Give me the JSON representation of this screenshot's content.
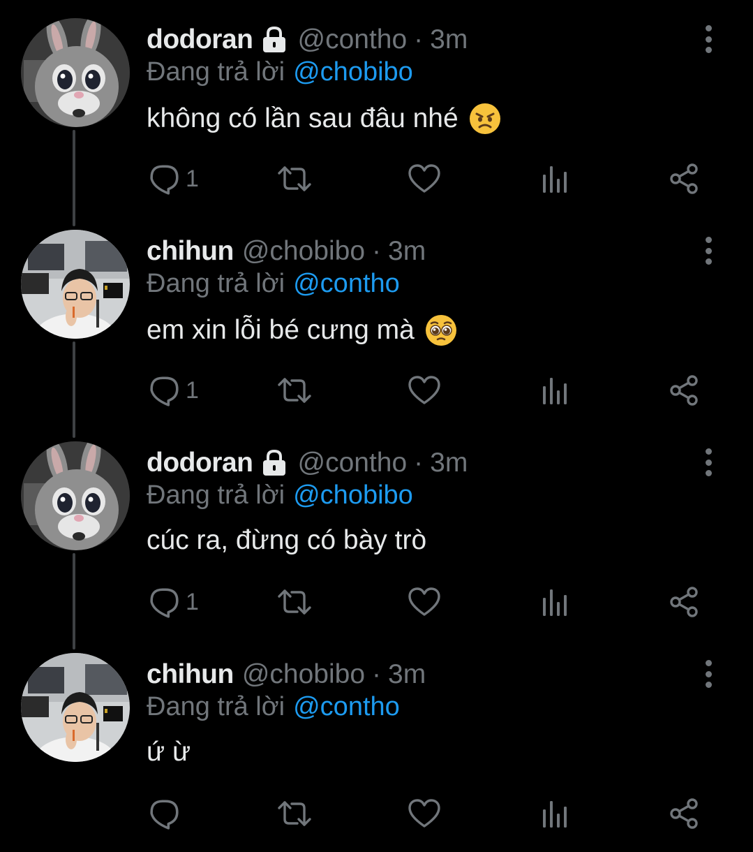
{
  "colors": {
    "background": "#000000",
    "primary_text": "#e7e9ea",
    "secondary_text": "#71767b",
    "link": "#1d9bf0",
    "thread_line": "#3e4144"
  },
  "tweets": [
    {
      "display_name": "dodoran",
      "protected": true,
      "handle": "@contho",
      "separator": "·",
      "time": "3m",
      "reply_prefix": "Đang trả lời",
      "reply_to": "@chobibo",
      "text": "không có lần sau đâu nhé",
      "emoji": "angry-face-icon",
      "reply_count": "1",
      "avatar": "bunny-mascot"
    },
    {
      "display_name": "chihun",
      "protected": false,
      "handle": "@chobibo",
      "separator": "·",
      "time": "3m",
      "reply_prefix": "Đang trả lời",
      "reply_to": "@contho",
      "text": "em xin lỗi bé cưng mà",
      "emoji": "pleading-face-icon",
      "reply_count": "1",
      "avatar": "person-photo"
    },
    {
      "display_name": "dodoran",
      "protected": true,
      "handle": "@contho",
      "separator": "·",
      "time": "3m",
      "reply_prefix": "Đang trả lời",
      "reply_to": "@chobibo",
      "text": "cúc ra, đừng có bày trò",
      "emoji": "",
      "reply_count": "1",
      "avatar": "bunny-mascot"
    },
    {
      "display_name": "chihun",
      "protected": false,
      "handle": "@chobibo",
      "separator": "·",
      "time": "3m",
      "reply_prefix": "Đang trả lời",
      "reply_to": "@contho",
      "text": "ứ ừ",
      "emoji": "",
      "reply_count": "",
      "avatar": "person-photo"
    }
  ]
}
